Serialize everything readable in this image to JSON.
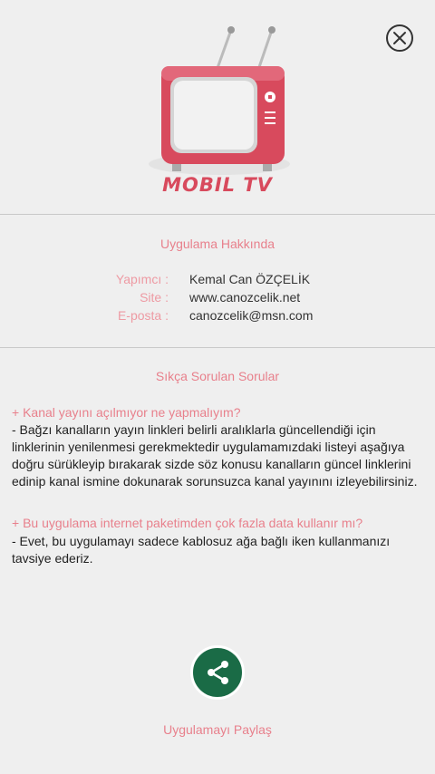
{
  "header": {
    "logo_text": "MOBIL TV"
  },
  "about": {
    "title": "Uygulama Hakkında",
    "rows": [
      {
        "label": "Yapımcı :",
        "value": "Kemal Can ÖZÇELİK"
      },
      {
        "label": "Site :",
        "value": "www.canozcelik.net"
      },
      {
        "label": "E-posta :",
        "value": "canozcelik@msn.com"
      }
    ]
  },
  "faq": {
    "title": "Sıkça Sorulan Sorular",
    "items": [
      {
        "question": "+ Kanal yayını açılmıyor ne yapmalıyım?",
        "answer": "- Bağzı kanalların yayın linkleri belirli aralıklarla güncellendiği için linklerinin yenilenmesi gerekmektedir uygulamamızdaki listeyi aşağıya doğru sürükleyip bırakarak sizde söz konusu kanalların güncel linklerini edinip kanal ismine dokunarak sorunsuzca kanal yayınını izleyebilirsiniz."
      },
      {
        "question": "+ Bu uygulama internet paketimden çok fazla data kullanır mı?",
        "answer": "- Evet, bu uygulamayı sadece kablosuz ağa bağlı iken kullanmanızı tavsiye ederiz."
      }
    ]
  },
  "share": {
    "label": "Uygulamayı Paylaş"
  },
  "icons": {
    "close": "close-icon",
    "share": "share-icon",
    "logo": "tv-icon"
  },
  "colors": {
    "accent": "#e8808c",
    "share_button": "#1a6b46",
    "tv_body": "#d84a5d"
  }
}
